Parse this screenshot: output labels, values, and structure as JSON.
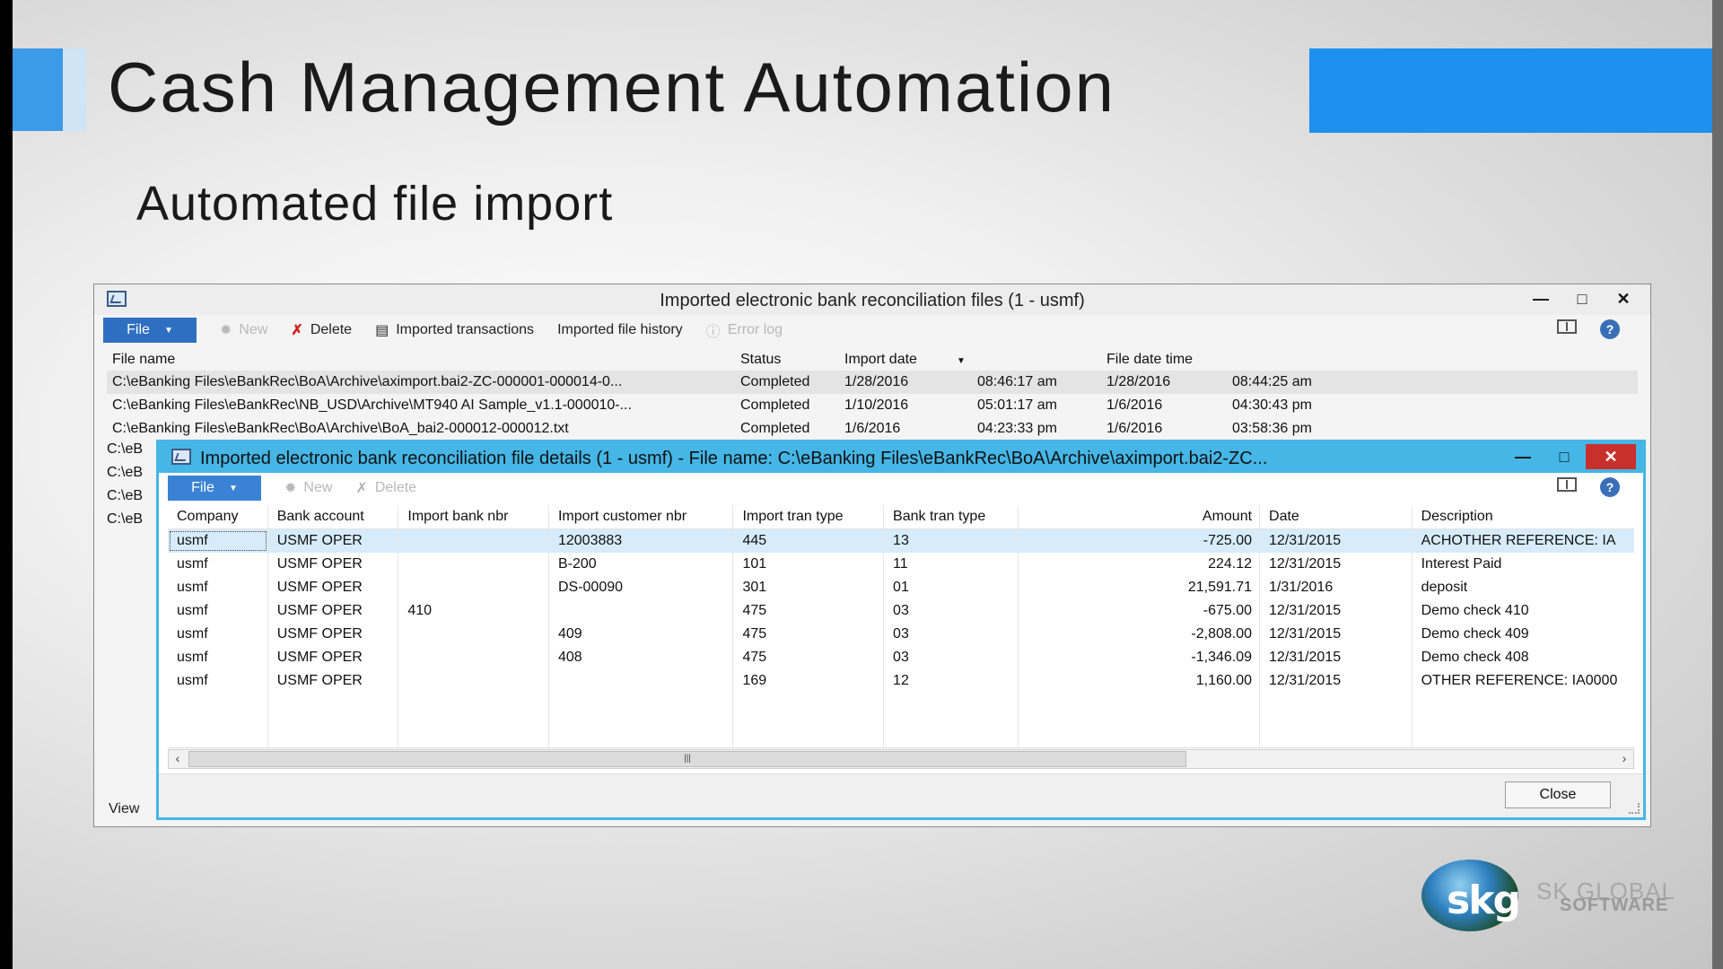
{
  "slide": {
    "title": "Cash Management Automation",
    "subtitle": "Automated file import",
    "colors": {
      "accent": "#1e90ee",
      "dialog_border": "#45b6e6"
    }
  },
  "main_window": {
    "title": "Imported electronic bank reconciliation files (1 - usmf)",
    "toolbar": {
      "file": "File",
      "new": "New",
      "delete": "Delete",
      "imported_transactions": "Imported transactions",
      "imported_file_history": "Imported file history",
      "error_log": "Error log"
    },
    "columns": {
      "file_name": "File name",
      "status": "Status",
      "import_date": "Import date",
      "file_date_time": "File date time"
    },
    "rows": [
      {
        "file_name": "C:\\eBanking Files\\eBankRec\\BoA\\Archive\\aximport.bai2-ZC-000001-000014-0...",
        "status": "Completed",
        "import_date": "1/28/2016",
        "import_time": "08:46:17 am",
        "file_date": "1/28/2016",
        "file_time": "08:44:25 am"
      },
      {
        "file_name": "C:\\eBanking Files\\eBankRec\\NB_USD\\Archive\\MT940 AI Sample_v1.1-000010-...",
        "status": "Completed",
        "import_date": "1/10/2016",
        "import_time": "05:01:17 am",
        "file_date": "1/6/2016",
        "file_time": "04:30:43 pm"
      },
      {
        "file_name": "C:\\eBanking Files\\eBankRec\\BoA\\Archive\\BoA_bai2-000012-000012.txt",
        "status": "Completed",
        "import_date": "1/6/2016",
        "import_time": "04:23:33 pm",
        "file_date": "1/6/2016",
        "file_time": "03:58:36 pm"
      }
    ],
    "truncated_rows": [
      "C:\\eB",
      "C:\\eB",
      "C:\\eB",
      "C:\\eB"
    ],
    "view_tab": "View"
  },
  "detail_window": {
    "title": "Imported electronic bank reconciliation file details (1 - usmf) - File name: C:\\eBanking Files\\eBankRec\\BoA\\Archive\\aximport.bai2-ZC...",
    "toolbar": {
      "file": "File",
      "new": "New",
      "delete": "Delete"
    },
    "columns": {
      "company": "Company",
      "bank_account": "Bank account",
      "import_bank_nbr": "Import bank nbr",
      "import_customer_nbr": "Import customer nbr",
      "import_tran_type": "Import tran type",
      "bank_tran_type": "Bank tran type",
      "amount": "Amount",
      "date": "Date",
      "description": "Description"
    },
    "rows": [
      {
        "company": "usmf",
        "bank_account": "USMF OPER",
        "import_bank_nbr": "",
        "import_customer_nbr": "12003883",
        "import_tran_type": "445",
        "bank_tran_type": "13",
        "amount": "-725.00",
        "date": "12/31/2015",
        "description": "ACHOTHER REFERENCE: IA"
      },
      {
        "company": "usmf",
        "bank_account": "USMF OPER",
        "import_bank_nbr": "",
        "import_customer_nbr": "B-200",
        "import_tran_type": "101",
        "bank_tran_type": "11",
        "amount": "224.12",
        "date": "12/31/2015",
        "description": "Interest Paid"
      },
      {
        "company": "usmf",
        "bank_account": "USMF OPER",
        "import_bank_nbr": "",
        "import_customer_nbr": "DS-00090",
        "import_tran_type": "301",
        "bank_tran_type": "01",
        "amount": "21,591.71",
        "date": "1/31/2016",
        "description": "deposit"
      },
      {
        "company": "usmf",
        "bank_account": "USMF OPER",
        "import_bank_nbr": "410",
        "import_customer_nbr": "",
        "import_tran_type": "475",
        "bank_tran_type": "03",
        "amount": "-675.00",
        "date": "12/31/2015",
        "description": "Demo check 410"
      },
      {
        "company": "usmf",
        "bank_account": "USMF OPER",
        "import_bank_nbr": "",
        "import_customer_nbr": "409",
        "import_tran_type": "475",
        "bank_tran_type": "03",
        "amount": "-2,808.00",
        "date": "12/31/2015",
        "description": "Demo check 409"
      },
      {
        "company": "usmf",
        "bank_account": "USMF OPER",
        "import_bank_nbr": "",
        "import_customer_nbr": "408",
        "import_tran_type": "475",
        "bank_tran_type": "03",
        "amount": "-1,346.09",
        "date": "12/31/2015",
        "description": "Demo check 408"
      },
      {
        "company": "usmf",
        "bank_account": "USMF OPER",
        "import_bank_nbr": "",
        "import_customer_nbr": "",
        "import_tran_type": "169",
        "bank_tran_type": "12",
        "amount": "1,160.00",
        "date": "12/31/2015",
        "description": "OTHER REFERENCE: IA0000"
      }
    ],
    "close": "Close"
  },
  "logo": {
    "mark": "skg",
    "name": "SK GLOBAL",
    "sub": "SOFTWARE"
  }
}
